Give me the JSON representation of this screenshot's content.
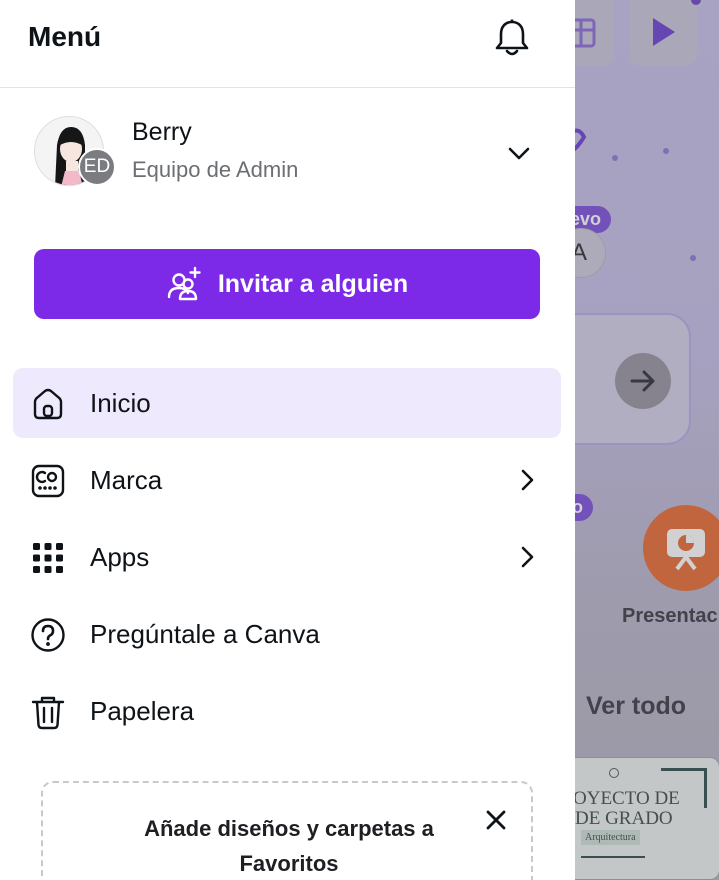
{
  "menu": {
    "title": "Menú",
    "profile": {
      "name": "Berry",
      "team": "Equipo de Admin",
      "team_initials": "ED"
    },
    "invite_label": "Invitar a alguien",
    "nav": [
      {
        "label": "Inicio",
        "icon": "home-icon",
        "active": true
      },
      {
        "label": "Marca",
        "icon": "brand-icon",
        "has_submenu": true
      },
      {
        "label": "Apps",
        "icon": "apps-grid-icon",
        "has_submenu": true
      },
      {
        "label": "Pregúntale a Canva",
        "icon": "help-icon"
      },
      {
        "label": "Papelera",
        "icon": "trash-icon"
      }
    ],
    "favorites_card": {
      "text_line1": "Añade diseños y carpetas a",
      "text_line2": "Favoritos"
    }
  },
  "background": {
    "badge_new": "evo",
    "avatar_letter": "A",
    "badge_pro": "o",
    "presentation_label": "Presentac",
    "see_all": "Ver todo",
    "thumb_line1": "OYECTO DE",
    "thumb_line2": "DE GRADO",
    "thumb_line3": "Arquitectura"
  },
  "colors": {
    "accent": "#7d2ae8",
    "active_bg": "#efe9fd",
    "overlay": "#b7b4c6"
  }
}
